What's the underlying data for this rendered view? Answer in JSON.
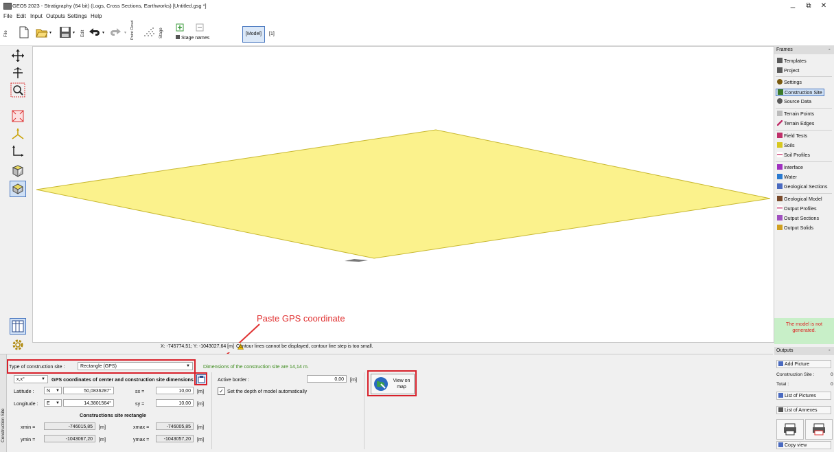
{
  "window": {
    "title": "GEO5 2023 - Stratigraphy (64 bit) (Logs, Cross Sections, Earthworks) [Untitled.gsg *]",
    "minimize": "–",
    "restore": "⧉",
    "close": "✕"
  },
  "menu": [
    "File",
    "Edit",
    "Input",
    "Outputs",
    "Settings",
    "Help"
  ],
  "toolbar": {
    "file_label": "File",
    "edit_label": "Edit",
    "point_cloud_label": "Point Cloud",
    "stage_label": "Stage",
    "stage_names": "Stage names",
    "model_button": "[Model]",
    "stage_number": "[1]"
  },
  "annotation": {
    "text": "Paste GPS coordinate"
  },
  "status": {
    "coords": "X: -745774,51; Y: -1043027,64 [m]",
    "warning": "Contour lines cannot be displayed, contour line step is too small."
  },
  "frames": {
    "header": "Frames",
    "items": [
      {
        "label": "Templates",
        "color": "#5a5a5a"
      },
      {
        "label": "Project",
        "color": "#5a5a5a"
      },
      {
        "label": "Settings",
        "color": "#7a5a10"
      },
      {
        "label": "Construction Site",
        "color": "#3b7a2a"
      },
      {
        "label": "Source Data",
        "color": "#5a5a5a"
      },
      {
        "label": "Terrain Points",
        "color": "#9a9a9a"
      },
      {
        "label": "Terrain Edges",
        "color": "#c0306a"
      },
      {
        "label": "Field Tests",
        "color": "#c0306a"
      },
      {
        "label": "Soils",
        "color": "#d8c820"
      },
      {
        "label": "Soil Profiles",
        "color": "#d05080"
      },
      {
        "label": "Interface",
        "color": "#a030c0"
      },
      {
        "label": "Water",
        "color": "#2a7ad0"
      },
      {
        "label": "Geological Sections",
        "color": "#4a6ac0"
      },
      {
        "label": "Geological Model",
        "color": "#7a4a2a"
      },
      {
        "label": "Output Profiles",
        "color": "#d05080"
      },
      {
        "label": "Output Sections",
        "color": "#a050c0"
      },
      {
        "label": "Output Solids",
        "color": "#d0a020"
      }
    ],
    "warning": "The model is not generated."
  },
  "outputs": {
    "header": "Outputs",
    "add_picture": "Add Picture",
    "construction_site_label": "Construction Site :",
    "construction_site_count": "0",
    "total_label": "Total :",
    "total_count": "0",
    "list_pictures": "List of Pictures",
    "list_annexes": "List of Annexes",
    "copy_view": "Copy view"
  },
  "construction": {
    "side_label": "Construction Site",
    "type_label": "Type of construction site :",
    "type_value": "Rectangle (GPS)",
    "dimension_note": "Dimensions of the construction site are 14,14 m.",
    "coord_format": "x,x°",
    "gps_header": "GPS coordinates of center and construction site dimensions",
    "latitude_label": "Latitude :",
    "latitude_dir": "N",
    "latitude_value": "50,0836287°",
    "longitude_label": "Longitude :",
    "longitude_dir": "E",
    "longitude_value": "14,3801564°",
    "sx_label": "sx =",
    "sx_value": "10,00",
    "sy_label": "sy =",
    "sy_value": "10,00",
    "unit_m": "[m]",
    "rect_header": "Constructions site rectangle",
    "xmin_label": "xmin =",
    "xmin_value": "-746015,85",
    "xmax_label": "xmax =",
    "xmax_value": "-746005,85",
    "ymin_label": "ymin =",
    "ymin_value": "-1043067,20",
    "ymax_label": "ymax =",
    "ymax_value": "-1043057,20",
    "active_border_label": "Active border :",
    "active_border_value": "0,00",
    "set_depth_label": "Set the depth of model automatically",
    "view_on_map": "View on map"
  }
}
